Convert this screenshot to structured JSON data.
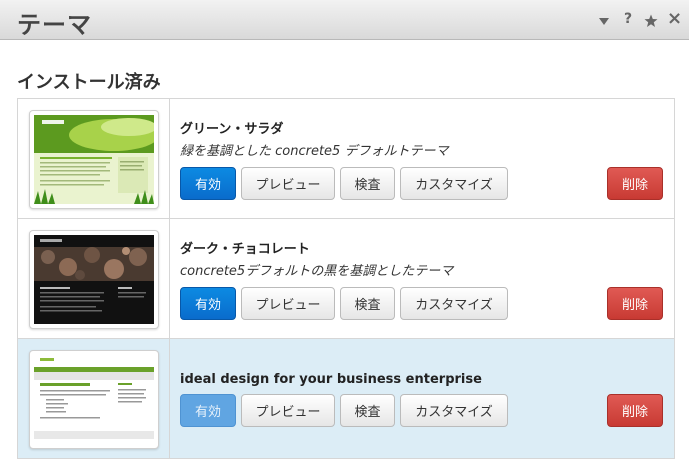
{
  "window": {
    "title": "テーマ",
    "icons": [
      "chevron-down-icon",
      "help-icon",
      "star-icon",
      "close-icon"
    ],
    "help_glyph": "?",
    "close_glyph": "×"
  },
  "section": {
    "title": "インストール済み"
  },
  "buttons": {
    "activate": "有効",
    "preview": "プレビュー",
    "inspect": "検査",
    "customize": "カスタマイズ",
    "delete": "削除"
  },
  "themes": [
    {
      "name": "グリーン・サラダ",
      "description": "緑を基調とした concrete5 デフォルトテーマ",
      "active": false
    },
    {
      "name": "ダーク・チョコレート",
      "description": "concrete5デフォルトの黒を基調としたテーマ",
      "active": false
    },
    {
      "name": "ideal design for your business enterprise",
      "description": "",
      "active": true
    }
  ],
  "thumbnails": {
    "green_salad_logo": "v.oncrt",
    "dark_chocolate_logo": "concrete5",
    "plain_yogurt_site": "my site",
    "plain_yogurt_heading": "WELCOME TO CONCRETE"
  },
  "colors": {
    "activate": "#0a7bd6",
    "delete": "#d0453f",
    "active_row": "#dcedf6"
  }
}
